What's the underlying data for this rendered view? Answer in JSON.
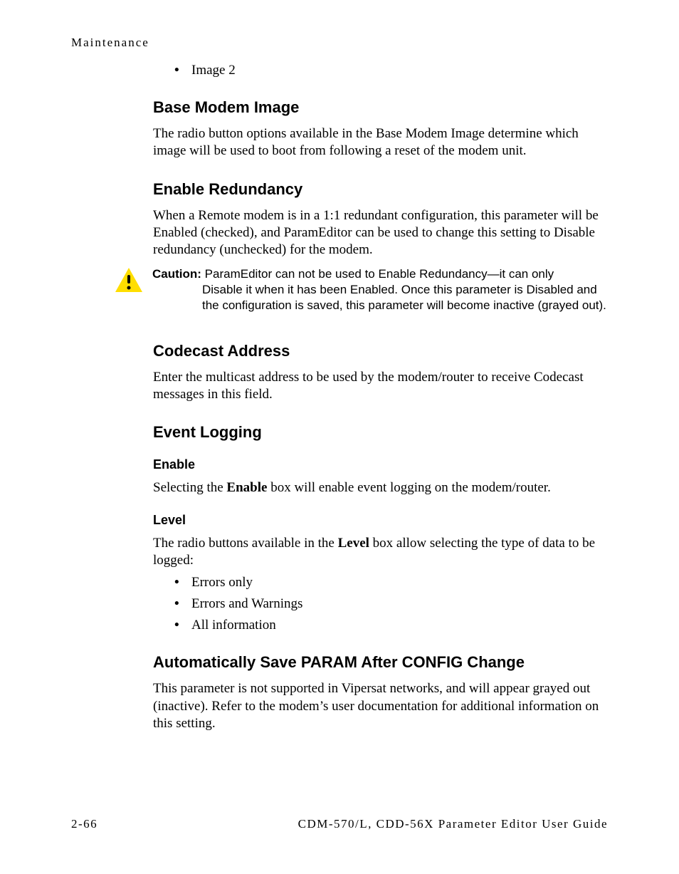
{
  "header": {
    "label": "Maintenance"
  },
  "top_bullet": {
    "item": "Image 2"
  },
  "sections": {
    "base_modem_image": {
      "title": "Base Modem Image",
      "body": "The radio button options available in the Base Modem Image determine which image will be used to boot from following a reset of the modem unit."
    },
    "enable_redundancy": {
      "title": "Enable Redundancy",
      "body": "When a Remote modem is in a 1:1 redundant configuration, this parameter will be Enabled (checked), and ParamEditor can be used to change this setting to Disable redundancy (unchecked) for the modem.",
      "caution_label": "Caution:",
      "caution_line1": "ParamEditor can not be used to Enable Redundancy—it can only",
      "caution_rest": "Disable it when it has been Enabled. Once this parameter is Disabled and the configuration is saved, this parameter will become inactive (grayed out)."
    },
    "codecast_address": {
      "title": "Codecast Address",
      "body": "Enter the multicast address to be used by the modem/router to receive Codecast messages in this field."
    },
    "event_logging": {
      "title": "Event Logging",
      "enable": {
        "title": "Enable",
        "pre": "Selecting the ",
        "bold": "Enable",
        "post": " box will enable event logging on the modem/router."
      },
      "level": {
        "title": "Level",
        "pre": "The radio buttons available in the ",
        "bold": "Level",
        "post": " box allow selecting the type of data to be logged:",
        "items": [
          "Errors only",
          "Errors and Warnings",
          "All information"
        ]
      }
    },
    "auto_save": {
      "title": "Automatically Save PARAM After CONFIG Change",
      "body": "This parameter is not supported in Vipersat networks, and will appear grayed out (inactive). Refer to the modem’s user documentation for additional information on this setting."
    }
  },
  "footer": {
    "page": "2-66",
    "doc": "CDM-570/L, CDD-56X Parameter Editor User Guide"
  }
}
